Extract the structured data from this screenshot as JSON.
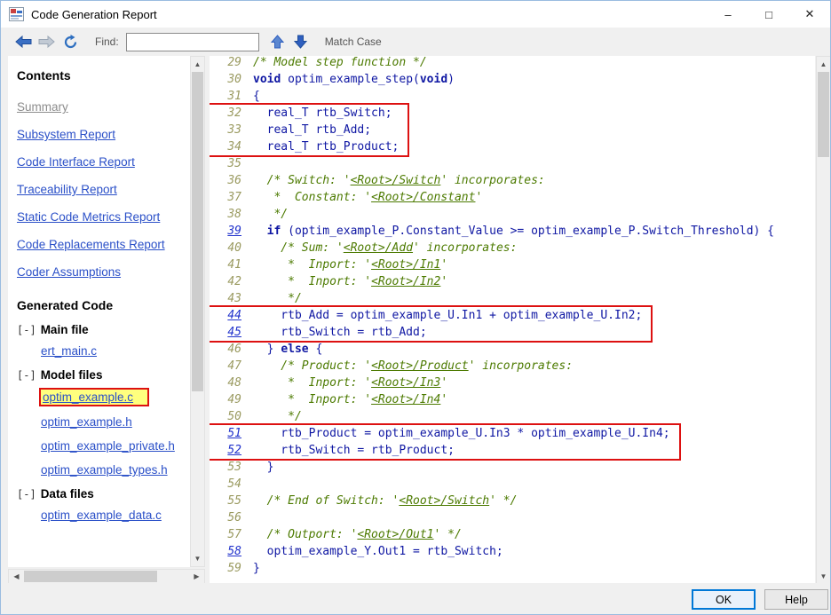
{
  "window": {
    "title": "Code Generation Report",
    "minimize": "–",
    "maximize": "□",
    "close": "✕"
  },
  "toolbar": {
    "find_label": "Find:",
    "find_value": "",
    "match_case": "Match Case"
  },
  "icons": {
    "scroll_up": "▲",
    "scroll_down": "▼",
    "scroll_left": "◀",
    "scroll_right": "▶"
  },
  "sidebar": {
    "contents_heading": "Contents",
    "links": [
      {
        "label": "Summary",
        "current": true
      },
      {
        "label": "Subsystem Report",
        "current": false
      },
      {
        "label": "Code Interface Report",
        "current": false
      },
      {
        "label": "Traceability Report",
        "current": false
      },
      {
        "label": "Static Code Metrics Report",
        "current": false
      },
      {
        "label": "Code Replacements Report",
        "current": false
      },
      {
        "label": "Coder Assumptions",
        "current": false
      }
    ],
    "generated_heading": "Generated Code",
    "tree": [
      {
        "toggle": "[-]",
        "label": "Main file",
        "files": [
          {
            "label": "ert_main.c",
            "highlight": false
          }
        ]
      },
      {
        "toggle": "[-]",
        "label": "Model files",
        "files": [
          {
            "label": "optim_example.c",
            "highlight": true
          },
          {
            "label": "optim_example.h",
            "highlight": false
          },
          {
            "label": "optim_example_private.h",
            "highlight": false
          },
          {
            "label": "optim_example_types.h",
            "highlight": false
          }
        ]
      },
      {
        "toggle": "[-]",
        "label": "Data files",
        "files": [
          {
            "label": "optim_example_data.c",
            "highlight": false
          }
        ]
      }
    ]
  },
  "code": {
    "lines": [
      {
        "n": 29,
        "link": false,
        "box": 0,
        "segs": [
          [
            "c",
            "/* Model step function */"
          ]
        ]
      },
      {
        "n": 30,
        "link": false,
        "box": 0,
        "segs": [
          [
            "k",
            "void"
          ],
          [
            "p",
            " optim_example_step("
          ],
          [
            "k",
            "void"
          ],
          [
            "p",
            ")"
          ]
        ]
      },
      {
        "n": 31,
        "link": false,
        "box": 0,
        "segs": [
          [
            "p",
            "{"
          ]
        ]
      },
      {
        "n": 32,
        "link": false,
        "box": 1,
        "segs": [
          [
            "p",
            "  real_T rtb_Switch;"
          ]
        ]
      },
      {
        "n": 33,
        "link": false,
        "box": 1,
        "segs": [
          [
            "p",
            "  real_T rtb_Add;"
          ]
        ]
      },
      {
        "n": 34,
        "link": false,
        "box": 1,
        "segs": [
          [
            "p",
            "  real_T rtb_Product;"
          ]
        ]
      },
      {
        "n": 35,
        "link": false,
        "box": 0,
        "segs": []
      },
      {
        "n": 36,
        "link": false,
        "box": 0,
        "segs": [
          [
            "c",
            "  /* Switch: '"
          ],
          [
            "l",
            "<Root>/Switch"
          ],
          [
            "c",
            "' incorporates:"
          ]
        ]
      },
      {
        "n": 37,
        "link": false,
        "box": 0,
        "segs": [
          [
            "c",
            "   *  Constant: '"
          ],
          [
            "l",
            "<Root>/Constant"
          ],
          [
            "c",
            "'"
          ]
        ]
      },
      {
        "n": 38,
        "link": false,
        "box": 0,
        "segs": [
          [
            "c",
            "   */"
          ]
        ]
      },
      {
        "n": 39,
        "link": true,
        "box": 0,
        "segs": [
          [
            "p",
            "  "
          ],
          [
            "k",
            "if"
          ],
          [
            "p",
            " (optim_example_P.Constant_Value >= optim_example_P.Switch_Threshold) {"
          ]
        ]
      },
      {
        "n": 40,
        "link": false,
        "box": 0,
        "segs": [
          [
            "c",
            "    /* Sum: '"
          ],
          [
            "l",
            "<Root>/Add"
          ],
          [
            "c",
            "' incorporates:"
          ]
        ]
      },
      {
        "n": 41,
        "link": false,
        "box": 0,
        "segs": [
          [
            "c",
            "     *  Inport: '"
          ],
          [
            "l",
            "<Root>/In1"
          ],
          [
            "c",
            "'"
          ]
        ]
      },
      {
        "n": 42,
        "link": false,
        "box": 0,
        "segs": [
          [
            "c",
            "     *  Inport: '"
          ],
          [
            "l",
            "<Root>/In2"
          ],
          [
            "c",
            "'"
          ]
        ]
      },
      {
        "n": 43,
        "link": false,
        "box": 0,
        "segs": [
          [
            "c",
            "     */"
          ]
        ]
      },
      {
        "n": 44,
        "link": true,
        "box": 2,
        "segs": [
          [
            "p",
            "    rtb_Add = optim_example_U.In1 + optim_example_U.In2;"
          ]
        ]
      },
      {
        "n": 45,
        "link": true,
        "box": 2,
        "segs": [
          [
            "p",
            "    rtb_Switch = rtb_Add;"
          ]
        ]
      },
      {
        "n": 46,
        "link": false,
        "box": 0,
        "segs": [
          [
            "p",
            "  } "
          ],
          [
            "k",
            "else"
          ],
          [
            "p",
            " {"
          ]
        ]
      },
      {
        "n": 47,
        "link": false,
        "box": 0,
        "segs": [
          [
            "c",
            "    /* Product: '"
          ],
          [
            "l",
            "<Root>/Product"
          ],
          [
            "c",
            "' incorporates:"
          ]
        ]
      },
      {
        "n": 48,
        "link": false,
        "box": 0,
        "segs": [
          [
            "c",
            "     *  Inport: '"
          ],
          [
            "l",
            "<Root>/In3"
          ],
          [
            "c",
            "'"
          ]
        ]
      },
      {
        "n": 49,
        "link": false,
        "box": 0,
        "segs": [
          [
            "c",
            "     *  Inport: '"
          ],
          [
            "l",
            "<Root>/In4"
          ],
          [
            "c",
            "'"
          ]
        ]
      },
      {
        "n": 50,
        "link": false,
        "box": 0,
        "segs": [
          [
            "c",
            "     */"
          ]
        ]
      },
      {
        "n": 51,
        "link": true,
        "box": 3,
        "segs": [
          [
            "p",
            "    rtb_Product = optim_example_U.In3 * optim_example_U.In4;"
          ]
        ]
      },
      {
        "n": 52,
        "link": true,
        "box": 3,
        "segs": [
          [
            "p",
            "    rtb_Switch = rtb_Product;"
          ]
        ]
      },
      {
        "n": 53,
        "link": false,
        "box": 0,
        "segs": [
          [
            "p",
            "  }"
          ]
        ]
      },
      {
        "n": 54,
        "link": false,
        "box": 0,
        "segs": []
      },
      {
        "n": 55,
        "link": false,
        "box": 0,
        "segs": [
          [
            "c",
            "  /* End of Switch: '"
          ],
          [
            "l",
            "<Root>/Switch"
          ],
          [
            "c",
            "' */"
          ]
        ]
      },
      {
        "n": 56,
        "link": false,
        "box": 0,
        "segs": []
      },
      {
        "n": 57,
        "link": false,
        "box": 0,
        "segs": [
          [
            "c",
            "  /* Outport: '"
          ],
          [
            "l",
            "<Root>/Out1"
          ],
          [
            "c",
            "' */"
          ]
        ]
      },
      {
        "n": 58,
        "link": true,
        "box": 0,
        "segs": [
          [
            "p",
            "  optim_example_Y.Out1 = rtb_Switch;"
          ]
        ]
      },
      {
        "n": 59,
        "link": false,
        "box": 0,
        "segs": [
          [
            "p",
            "}"
          ]
        ]
      }
    ]
  },
  "footer": {
    "ok_label": "OK",
    "help_label": "Help"
  },
  "colors": {
    "highlight_box_red": "#dd1111",
    "search_highlight_yellow": "#ffff7e",
    "link_blue": "#2b50c8",
    "comment_green": "#4c7a00",
    "code_navy": "#0f17a3",
    "line_number_olive": "#9a9a60",
    "default_button_blue": "#0078d7"
  }
}
